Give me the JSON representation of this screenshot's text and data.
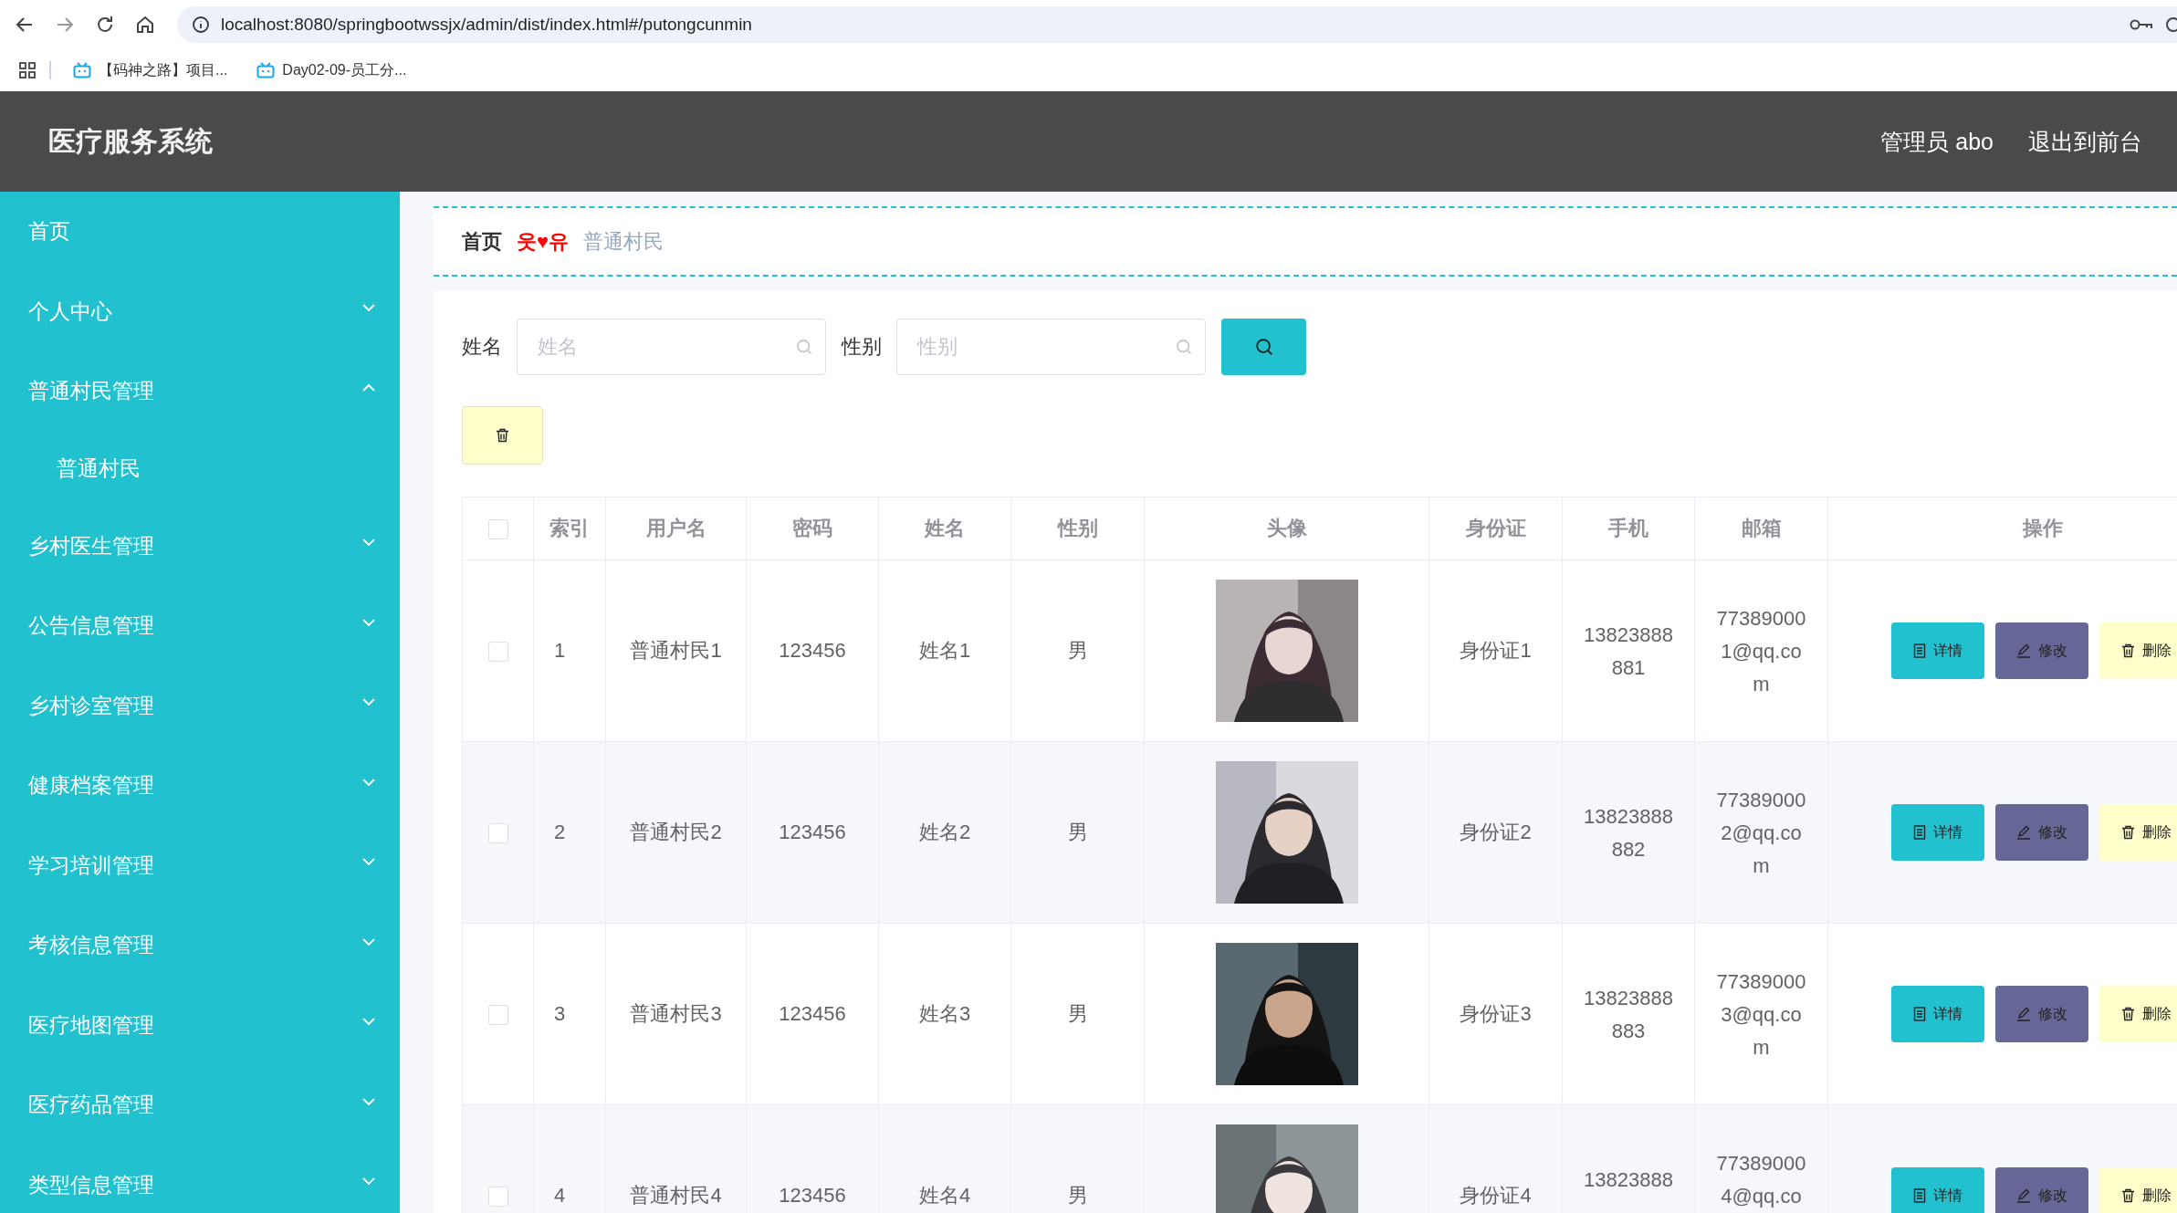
{
  "browser": {
    "url": "localhost:8080/springbootwssjx/admin/dist/index.html#/putongcunmin",
    "bookmarks": [
      "【码神之路】项目...",
      "Day02-09-员工分..."
    ]
  },
  "header": {
    "title": "医疗服务系统",
    "user": "管理员 abo",
    "logout": "退出到前台"
  },
  "sidebar": {
    "items": [
      {
        "label": "首页",
        "kind": "link"
      },
      {
        "label": "个人中心",
        "kind": "menu",
        "expanded": false
      },
      {
        "label": "普通村民管理",
        "kind": "menu",
        "expanded": true,
        "children": [
          {
            "label": "普通村民"
          }
        ]
      },
      {
        "label": "乡村医生管理",
        "kind": "menu",
        "expanded": false
      },
      {
        "label": "公告信息管理",
        "kind": "menu",
        "expanded": false
      },
      {
        "label": "乡村诊室管理",
        "kind": "menu",
        "expanded": false
      },
      {
        "label": "健康档案管理",
        "kind": "menu",
        "expanded": false
      },
      {
        "label": "学习培训管理",
        "kind": "menu",
        "expanded": false
      },
      {
        "label": "考核信息管理",
        "kind": "menu",
        "expanded": false
      },
      {
        "label": "医疗地图管理",
        "kind": "menu",
        "expanded": false
      },
      {
        "label": "医疗药品管理",
        "kind": "menu",
        "expanded": false
      },
      {
        "label": "类型信息管理",
        "kind": "menu",
        "expanded": false
      }
    ]
  },
  "breadcrumb": {
    "items": [
      "首页",
      "普通村民"
    ],
    "separator": "웃♥유"
  },
  "search": {
    "fields": [
      {
        "label": "姓名",
        "placeholder": "姓名"
      },
      {
        "label": "性别",
        "placeholder": "性别"
      }
    ]
  },
  "table": {
    "all_checked": false,
    "columns": [
      "索引",
      "用户名",
      "密码",
      "姓名",
      "性别",
      "头像",
      "身份证",
      "手机",
      "邮箱",
      "操作"
    ],
    "rows": [
      {
        "checked": false,
        "index": "1",
        "username": "普通村民1",
        "password": "123456",
        "name": "姓名1",
        "gender": "男",
        "avatar": {
          "kind": "picture"
        },
        "id_card": "身份证1",
        "phone": "13823888881",
        "email": "773890001@qq.com",
        "actions": [
          {
            "kind": "detail",
            "label": "详情"
          },
          {
            "kind": "edit",
            "label": "修改"
          },
          {
            "kind": "delete",
            "label": "删除"
          }
        ]
      },
      {
        "checked": false,
        "index": "2",
        "username": "普通村民2",
        "password": "123456",
        "name": "姓名2",
        "gender": "男",
        "avatar": {
          "kind": "picture"
        },
        "id_card": "身份证2",
        "phone": "13823888882",
        "email": "773890002@qq.com",
        "actions": [
          {
            "kind": "detail",
            "label": "详情"
          },
          {
            "kind": "edit",
            "label": "修改"
          },
          {
            "kind": "delete",
            "label": "删除"
          }
        ]
      },
      {
        "checked": false,
        "index": "3",
        "username": "普通村民3",
        "password": "123456",
        "name": "姓名3",
        "gender": "男",
        "avatar": {
          "kind": "picture"
        },
        "id_card": "身份证3",
        "phone": "13823888883",
        "email": "773890003@qq.com",
        "actions": [
          {
            "kind": "detail",
            "label": "详情"
          },
          {
            "kind": "edit",
            "label": "修改"
          },
          {
            "kind": "delete",
            "label": "删除"
          }
        ]
      },
      {
        "checked": false,
        "index": "4",
        "username": "普通村民4",
        "password": "123456",
        "name": "姓名4",
        "gender": "男",
        "avatar": {
          "kind": "picture"
        },
        "id_card": "身份证4",
        "phone": "13823888",
        "email": "773890004@qq.co",
        "actions": [
          {
            "kind": "detail",
            "label": "详情"
          },
          {
            "kind": "edit",
            "label": "修改"
          },
          {
            "kind": "delete",
            "label": "删除"
          }
        ]
      }
    ]
  }
}
